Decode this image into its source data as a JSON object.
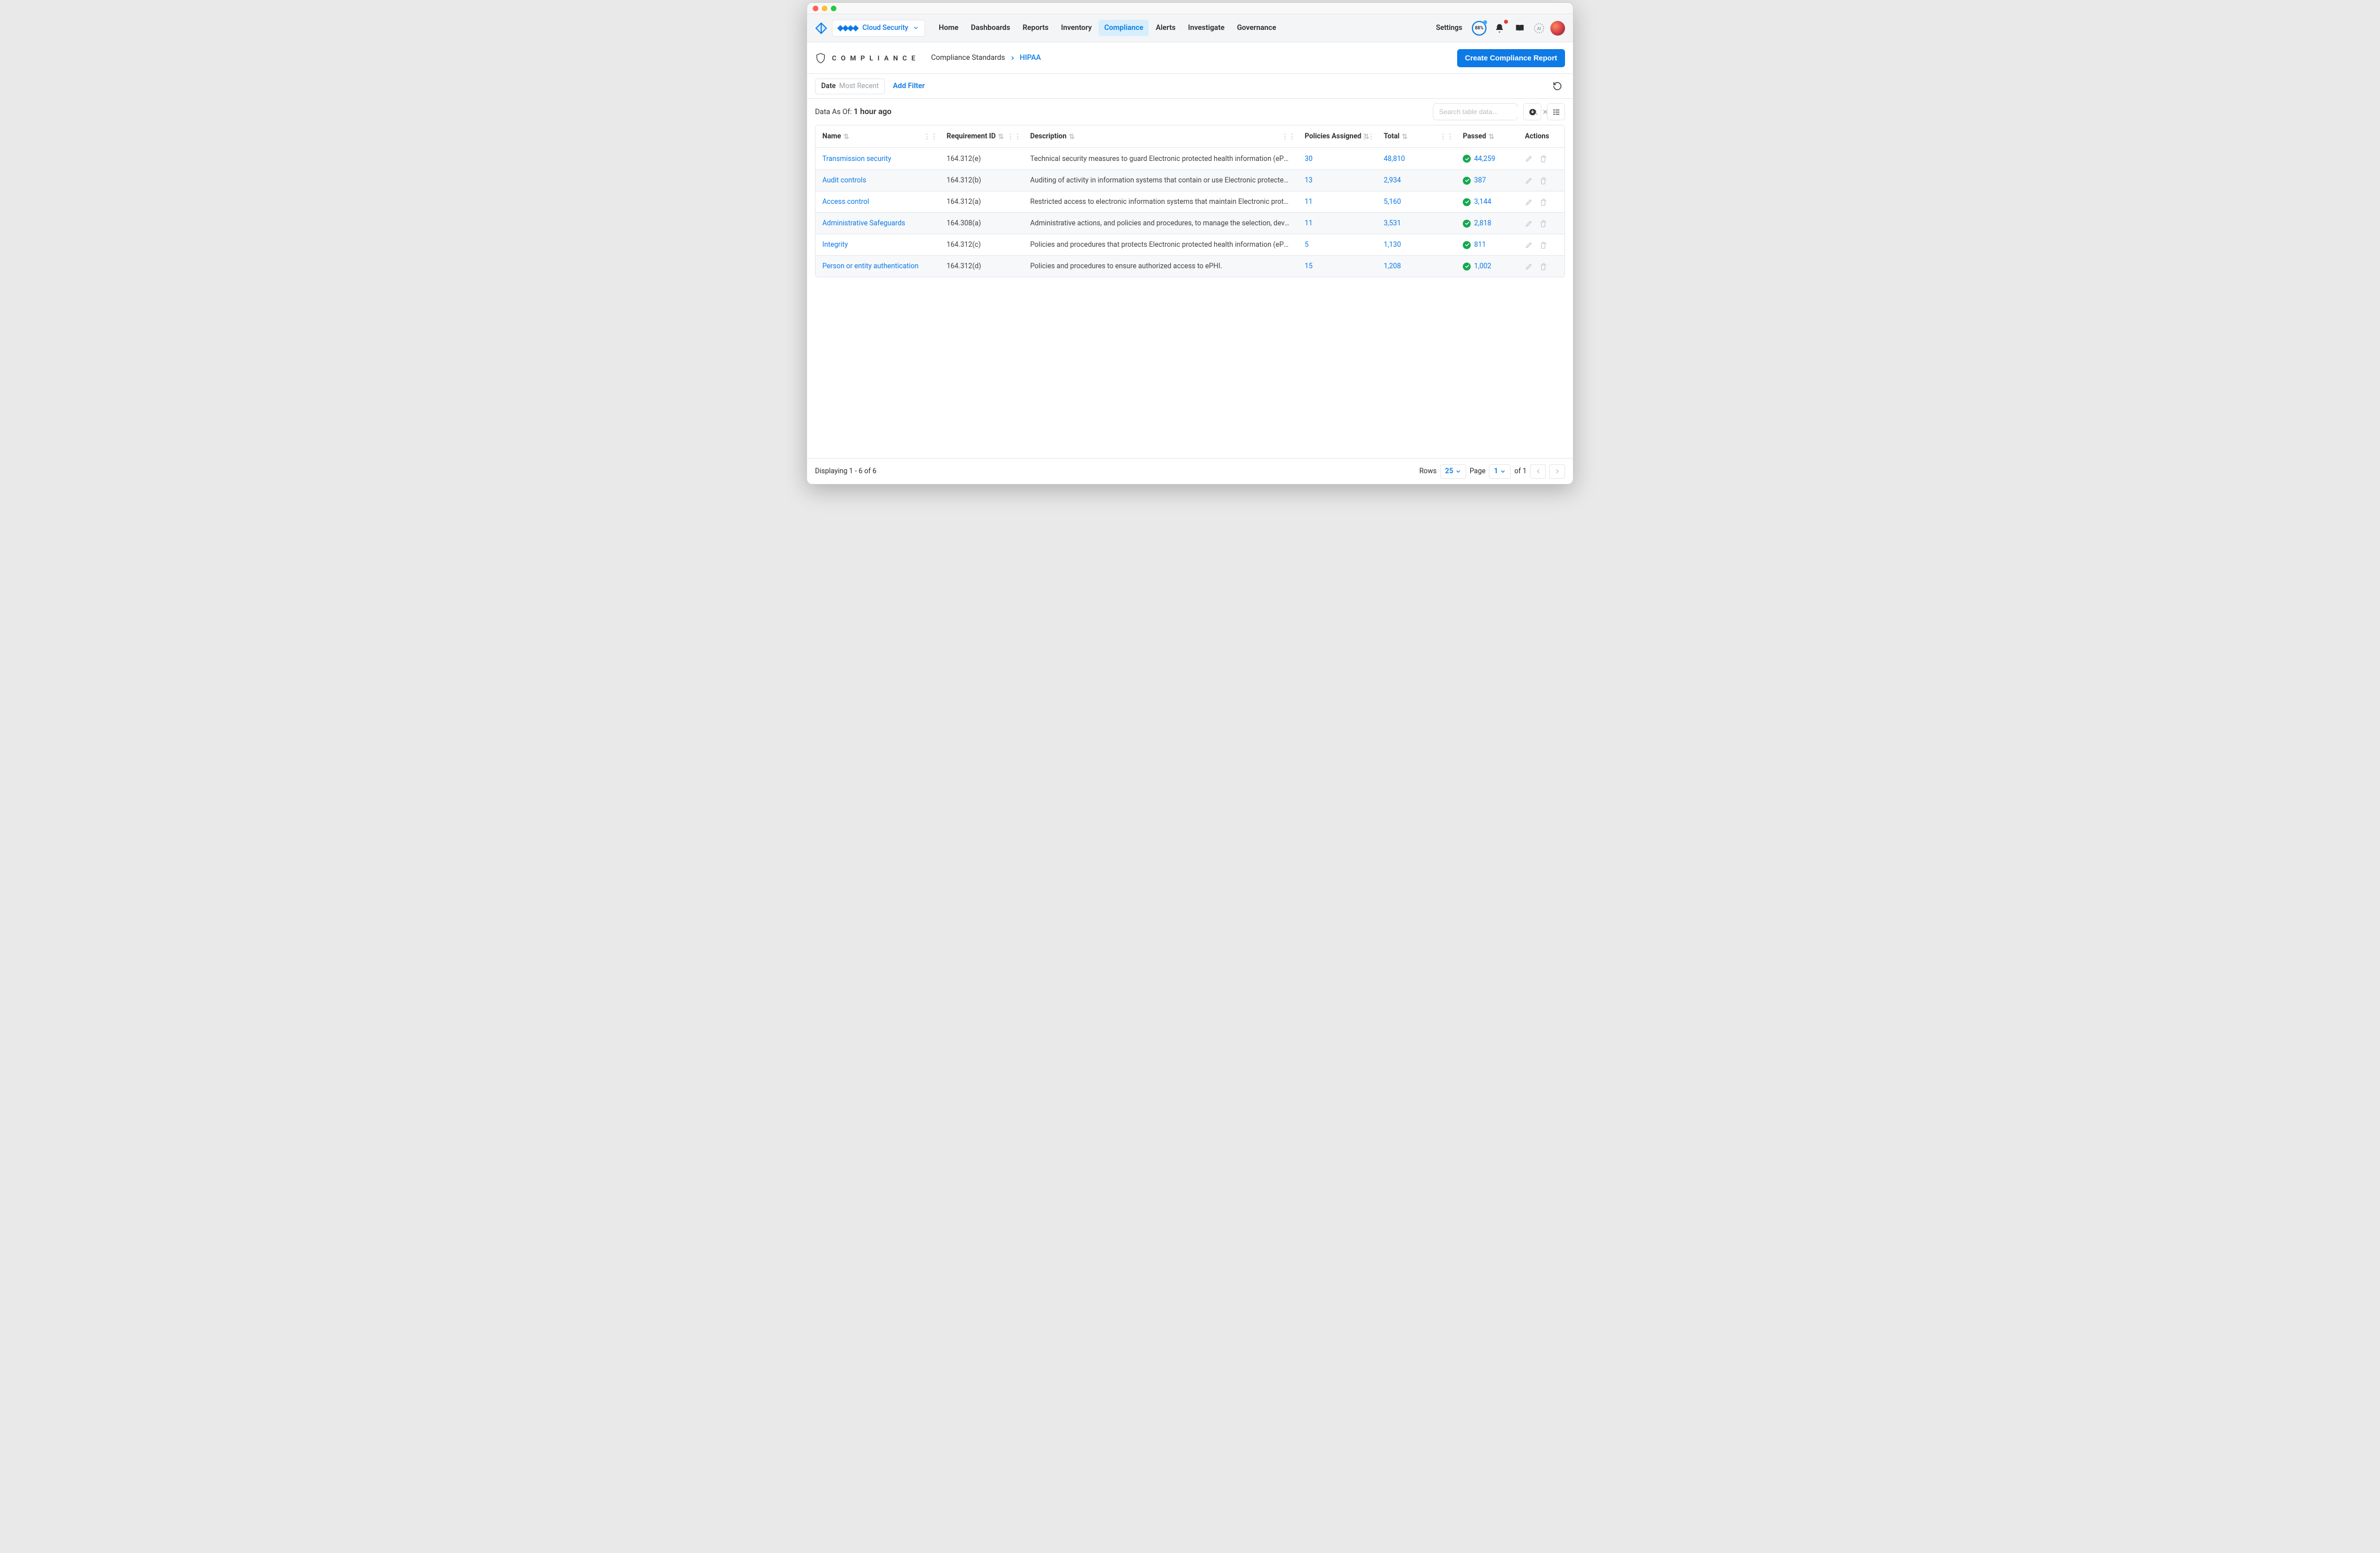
{
  "workspace": {
    "label": "Cloud Security"
  },
  "nav": {
    "items": [
      "Home",
      "Dashboards",
      "Reports",
      "Inventory",
      "Compliance",
      "Alerts",
      "Investigate",
      "Governance"
    ],
    "activeIndex": 4,
    "settings": "Settings",
    "score": "88%"
  },
  "subheader": {
    "sectionTitle": "COMPLIANCE",
    "breadcrumb": {
      "root": "Compliance Standards",
      "current": "HIPAA"
    },
    "primaryButton": "Create Compliance Report"
  },
  "filter": {
    "dateLabel": "Date",
    "dateValue": "Most Recent",
    "addFilter": "Add Filter"
  },
  "asOf": {
    "label": "Data As Of:",
    "value": "1 hour ago"
  },
  "search": {
    "placeholder": "Search table data..."
  },
  "table": {
    "headers": {
      "name": "Name",
      "requirement": "Requirement ID",
      "description": "Description",
      "policies": "Policies Assigned",
      "total": "Total",
      "passed": "Passed",
      "actions": "Actions"
    },
    "rows": [
      {
        "name": "Transmission security",
        "req": "164.312(e)",
        "desc": "Technical security measures to guard Electronic protected health information (ePHI), and protect d...",
        "policies": "30",
        "total": "48,810",
        "passed": "44,259"
      },
      {
        "name": "Audit controls",
        "req": "164.312(b)",
        "desc": "Auditing of activity in information systems that contain or use Electronic protected health informati...",
        "policies": "13",
        "total": "2,934",
        "passed": "387"
      },
      {
        "name": "Access control",
        "req": "164.312(a)",
        "desc": "Restricted access to electronic information systems that maintain Electronic protected health infor...",
        "policies": "11",
        "total": "5,160",
        "passed": "3,144"
      },
      {
        "name": "Administrative Safeguards",
        "req": "164.308(a)",
        "desc": "Administrative actions, and policies and procedures, to manage the selection, development, implem...",
        "policies": "11",
        "total": "3,531",
        "passed": "2,818"
      },
      {
        "name": "Integrity",
        "req": "164.312(c)",
        "desc": "Policies and procedures that protects Electronic protected health information (ePHI) from imprope...",
        "policies": "5",
        "total": "1,130",
        "passed": "811"
      },
      {
        "name": "Person or entity authentication",
        "req": "164.312(d)",
        "desc": "Policies and procedures to ensure authorized access to ePHI.",
        "policies": "15",
        "total": "1,208",
        "passed": "1,002"
      }
    ]
  },
  "footer": {
    "displaying": "Displaying 1 - 6 of 6",
    "rowsLabel": "Rows",
    "rowsValue": "25",
    "pageLabel": "Page",
    "pageValue": "1",
    "pageTotal": "of 1"
  }
}
